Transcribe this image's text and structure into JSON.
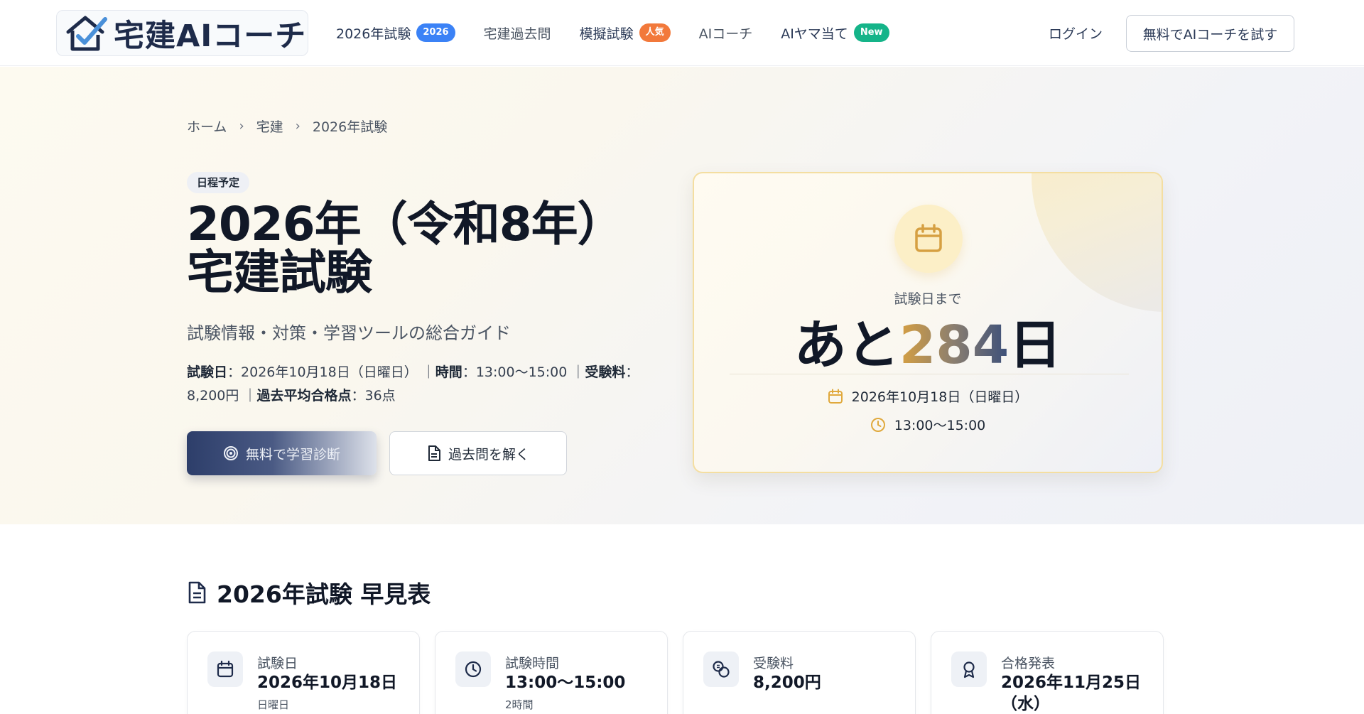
{
  "header": {
    "logo_text": "宅建AIコーチ",
    "nav": [
      {
        "label": "2026年試験",
        "badge": "2026"
      },
      {
        "label": "宅建過去問"
      },
      {
        "label": "模擬試験",
        "badge": "人気"
      },
      {
        "label": "AIコーチ"
      },
      {
        "label": "AIヤマ当て",
        "badge": "New"
      }
    ],
    "login": "ログイン",
    "cta": "無料でAIコーチを試す"
  },
  "hero": {
    "breadcrumb": [
      "ホーム",
      "宅建",
      "2026年試験"
    ],
    "status_pill": "日程予定",
    "title_line1": "2026年（令和8年）",
    "title_line2": "宅建試験",
    "subtitle": "試験情報・対策・学習ツールの総合ガイド",
    "info": {
      "exam_date_label": "試験日",
      "exam_date": "2026年10月18日（日曜日）",
      "time_label": "時間",
      "time": "13:00〜15:00",
      "fee_label": "受験料",
      "fee": "8,200円",
      "avg_label": "過去平均合格点",
      "avg": "36点"
    },
    "primary_button": "無料で学習診断",
    "secondary_button": "過去問を解く"
  },
  "countdown": {
    "label": "試験日まで",
    "prefix": "あと",
    "days": "284",
    "suffix": "日",
    "date": "2026年10月18日（日曜日）",
    "time": "13:00〜15:00"
  },
  "quick": {
    "title": "2026年試験 早見表",
    "cards": [
      {
        "label": "試験日",
        "value": "2026年10月18日",
        "sub": "日曜日"
      },
      {
        "label": "試験時間",
        "value": "13:00〜15:00",
        "sub": "2時間"
      },
      {
        "label": "受験料",
        "value": "8,200円",
        "sub": ""
      },
      {
        "label": "合格発表",
        "value": "2026年11月25日",
        "value2": "（水）"
      }
    ]
  },
  "colors": {
    "navy": "#1e2b4a",
    "accent_blue": "#3b82f6",
    "accent_orange": "#f2793b",
    "accent_green": "#15b489",
    "gold": "#d6a042"
  }
}
